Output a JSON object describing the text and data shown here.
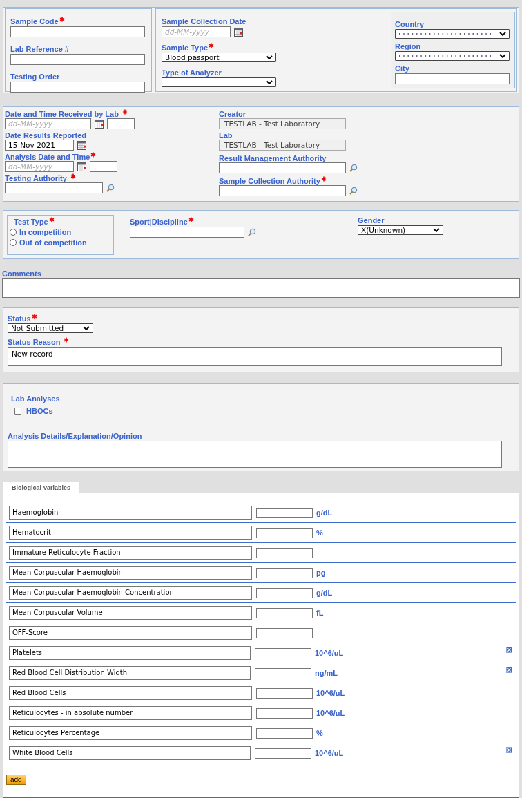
{
  "sample": {
    "sample_code": {
      "label": "Sample Code",
      "required": true
    },
    "lab_reference": {
      "label": "Lab Reference #",
      "required": false
    },
    "testing_order": {
      "label": "Testing Order",
      "required": false
    },
    "collection_date": {
      "label": "Sample Collection Date",
      "required": false,
      "placeholder": "dd-MM-yyyy"
    },
    "sample_type": {
      "label": "Sample Type",
      "required": true,
      "value": "Blood passport"
    },
    "analyzer_type": {
      "label": "Type of Analyzer",
      "required": false
    },
    "country": {
      "label": "Country"
    },
    "region": {
      "label": "Region"
    },
    "city": {
      "label": "City"
    }
  },
  "lab": {
    "received": {
      "label": "Date and Time Received by Lab",
      "required": true,
      "placeholder": "dd-MM-yyyy"
    },
    "reported": {
      "label": "Date Results Reported",
      "required": false,
      "value": "15-Nov-2021"
    },
    "analysis": {
      "label": "Analysis Date and Time",
      "required": true,
      "placeholder": "dd-MM-yyyy"
    },
    "testing_authority": {
      "label": "Testing Authority",
      "required": true
    },
    "creator": {
      "label": "Creator",
      "value": "TESTLAB - Test Laboratory",
      "disabled": true
    },
    "lab": {
      "label": "Lab",
      "value": "TESTLAB - Test Laboratory",
      "disabled": true
    },
    "result_authority": {
      "label": "Result Management Authority",
      "required": false
    },
    "collection_authority": {
      "label": "Sample Collection Authority",
      "required": true
    }
  },
  "test": {
    "test_type": {
      "label": "Test Type",
      "required": true,
      "options": [
        {
          "label": "In competition",
          "selected": false
        },
        {
          "label": "Out of competition",
          "selected": false
        }
      ]
    },
    "sport": {
      "label": "Sport|Discipline",
      "required": true
    },
    "gender": {
      "label": "Gender",
      "value": "X(Unknown)"
    }
  },
  "comments": {
    "label": "Comments"
  },
  "status": {
    "status": {
      "label": "Status",
      "required": true,
      "value": "Not Submitted"
    },
    "reason": {
      "label": "Status Reason",
      "required": true,
      "value": "New record"
    }
  },
  "lab_analyses": {
    "title": "Lab Analyses",
    "checks": [
      {
        "label": "HBOCs",
        "checked": false
      }
    ],
    "details": {
      "label": "Analysis Details/Explanation/Opinion"
    }
  },
  "tabs": [
    {
      "label": "Biological Variables",
      "selected": true
    }
  ],
  "variables": [
    {
      "name": "Haemoglobin",
      "unit": "g/dL",
      "removable": false
    },
    {
      "name": "Hematocrit",
      "unit": "%",
      "removable": false
    },
    {
      "name": "Immature Reticulocyte Fraction",
      "removable": false
    },
    {
      "name": "Mean Corpuscular Haemoglobin",
      "unit": "pg",
      "removable": false
    },
    {
      "name": "Mean Corpuscular Haemoglobin Concentration",
      "unit": "g/dL",
      "removable": false
    },
    {
      "name": "Mean Corpuscular Volume",
      "unit": "fL",
      "removable": false
    },
    {
      "name": "OFF-Score",
      "removable": false
    },
    {
      "name": "Platelets",
      "unit": "10^6/uL",
      "removable": true
    },
    {
      "name": "Red Blood Cell Distribution Width",
      "unit": "ng/mL",
      "removable": true
    },
    {
      "name": "Red Blood Cells",
      "unit": "10^6/uL",
      "removable": false
    },
    {
      "name": "Reticulocytes - in absolute number",
      "unit": "10^6/uL",
      "removable": false
    },
    {
      "name": "Reticulocytes Percentage",
      "unit": "%",
      "removable": false
    },
    {
      "name": "White Blood Cells",
      "unit": "10^6/uL",
      "removable": true
    }
  ],
  "add_button": "add"
}
